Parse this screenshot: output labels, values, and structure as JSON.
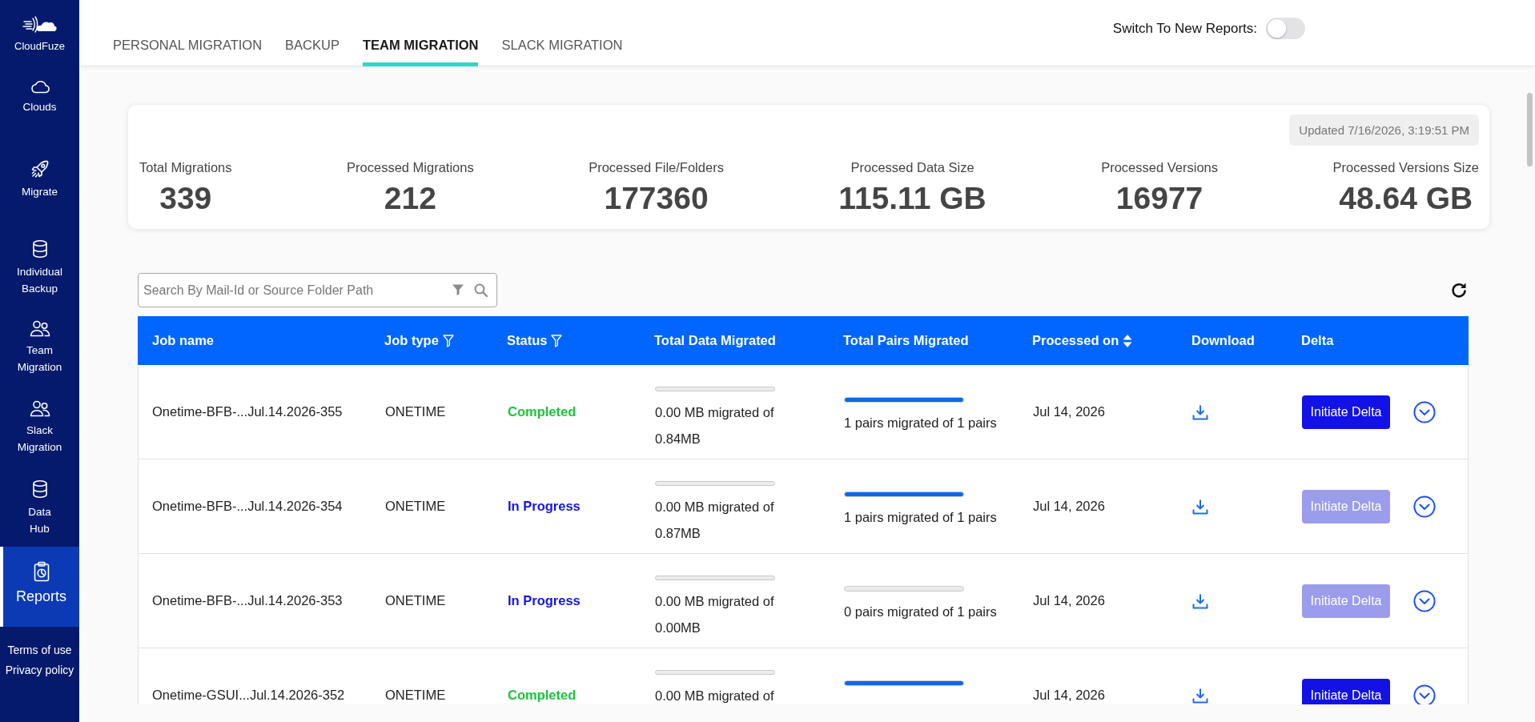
{
  "sidebar": {
    "brand": "CloudFuze",
    "items": [
      {
        "label": "Clouds",
        "kind": "cloud",
        "selected": false
      },
      {
        "label": "Migrate",
        "kind": "rocket",
        "selected": false
      },
      {
        "label": "Individual Backup",
        "kind": "database",
        "selected": false
      },
      {
        "label": "Team Migration",
        "kind": "users",
        "selected": false
      },
      {
        "label": "Slack Migration",
        "kind": "users",
        "selected": false
      },
      {
        "label": "Data Hub",
        "kind": "database",
        "selected": false
      },
      {
        "label": "Reports",
        "kind": "report",
        "selected": true
      }
    ],
    "links": [
      "Terms of use",
      "Privacy policy"
    ]
  },
  "tabs": [
    {
      "label": "PERSONAL MIGRATION",
      "selected": false
    },
    {
      "label": "BACKUP",
      "selected": false
    },
    {
      "label": "TEAM MIGRATION",
      "selected": true
    },
    {
      "label": "SLACK MIGRATION",
      "selected": false
    }
  ],
  "report_switch": {
    "label": "Switch To New Reports:",
    "on": false
  },
  "summary": {
    "updated": "Updated 7/16/2026, 3:19:51 PM",
    "stats": [
      {
        "label": "Total Migrations",
        "value": "339"
      },
      {
        "label": "Processed Migrations",
        "value": "212"
      },
      {
        "label": "Processed File/Folders",
        "value": "177360"
      },
      {
        "label": "Processed Data Size",
        "value": "115.11 GB"
      },
      {
        "label": "Processed Versions",
        "value": "16977"
      },
      {
        "label": "Processed Versions Size",
        "value": "48.64 GB"
      }
    ]
  },
  "search": {
    "placeholder": "Search By Mail-Id or Source Folder Path"
  },
  "table": {
    "columns": [
      {
        "label": "Job name",
        "kind": "plain"
      },
      {
        "label": "Job type",
        "kind": "filter"
      },
      {
        "label": "Status",
        "kind": "filter"
      },
      {
        "label": "Total Data Migrated",
        "kind": "plain"
      },
      {
        "label": "Total Pairs Migrated",
        "kind": "plain"
      },
      {
        "label": "Processed on",
        "kind": "sort"
      },
      {
        "label": "Download",
        "kind": "plain"
      },
      {
        "label": "Delta",
        "kind": "plain"
      }
    ],
    "rows": [
      {
        "job_name": "Onetime-BFB-...Jul.14.2026-355",
        "job_type": "ONETIME",
        "status": {
          "label": "Completed",
          "kind": "completed"
        },
        "data_migrated": {
          "level": 0,
          "text": "0.00 MB migrated of 0.84MB"
        },
        "pairs_migrated": {
          "level": 1,
          "text": "1 pairs migrated of 1 pairs"
        },
        "processed_on": "Jul 14, 2026",
        "delta": {
          "label": "Initiate Delta",
          "disabled": false
        }
      },
      {
        "job_name": "Onetime-BFB-...Jul.14.2026-354",
        "job_type": "ONETIME",
        "status": {
          "label": "In Progress",
          "kind": "in_progress"
        },
        "data_migrated": {
          "level": 0,
          "text": "0.00 MB migrated of 0.87MB"
        },
        "pairs_migrated": {
          "level": 1,
          "text": "1 pairs migrated of 1 pairs"
        },
        "processed_on": "Jul 14, 2026",
        "delta": {
          "label": "Initiate Delta",
          "disabled": true
        }
      },
      {
        "job_name": "Onetime-BFB-...Jul.14.2026-353",
        "job_type": "ONETIME",
        "status": {
          "label": "In Progress",
          "kind": "in_progress"
        },
        "data_migrated": {
          "level": 0,
          "text": "0.00 MB migrated of 0.00MB"
        },
        "pairs_migrated": {
          "level": 0,
          "text": "0 pairs migrated of 1 pairs"
        },
        "processed_on": "Jul 14, 2026",
        "delta": {
          "label": "Initiate Delta",
          "disabled": true
        }
      },
      {
        "job_name": "Onetime-GSUI...Jul.14.2026-352",
        "job_type": "ONETIME",
        "status": {
          "label": "Completed",
          "kind": "completed"
        },
        "data_migrated": {
          "level": 0,
          "text": "0.00 MB migrated of"
        },
        "pairs_migrated": {
          "level": 1
        },
        "processed_on": "Jul 14, 2026",
        "delta": {
          "label": "Initiate Delta",
          "disabled": false
        }
      }
    ]
  }
}
